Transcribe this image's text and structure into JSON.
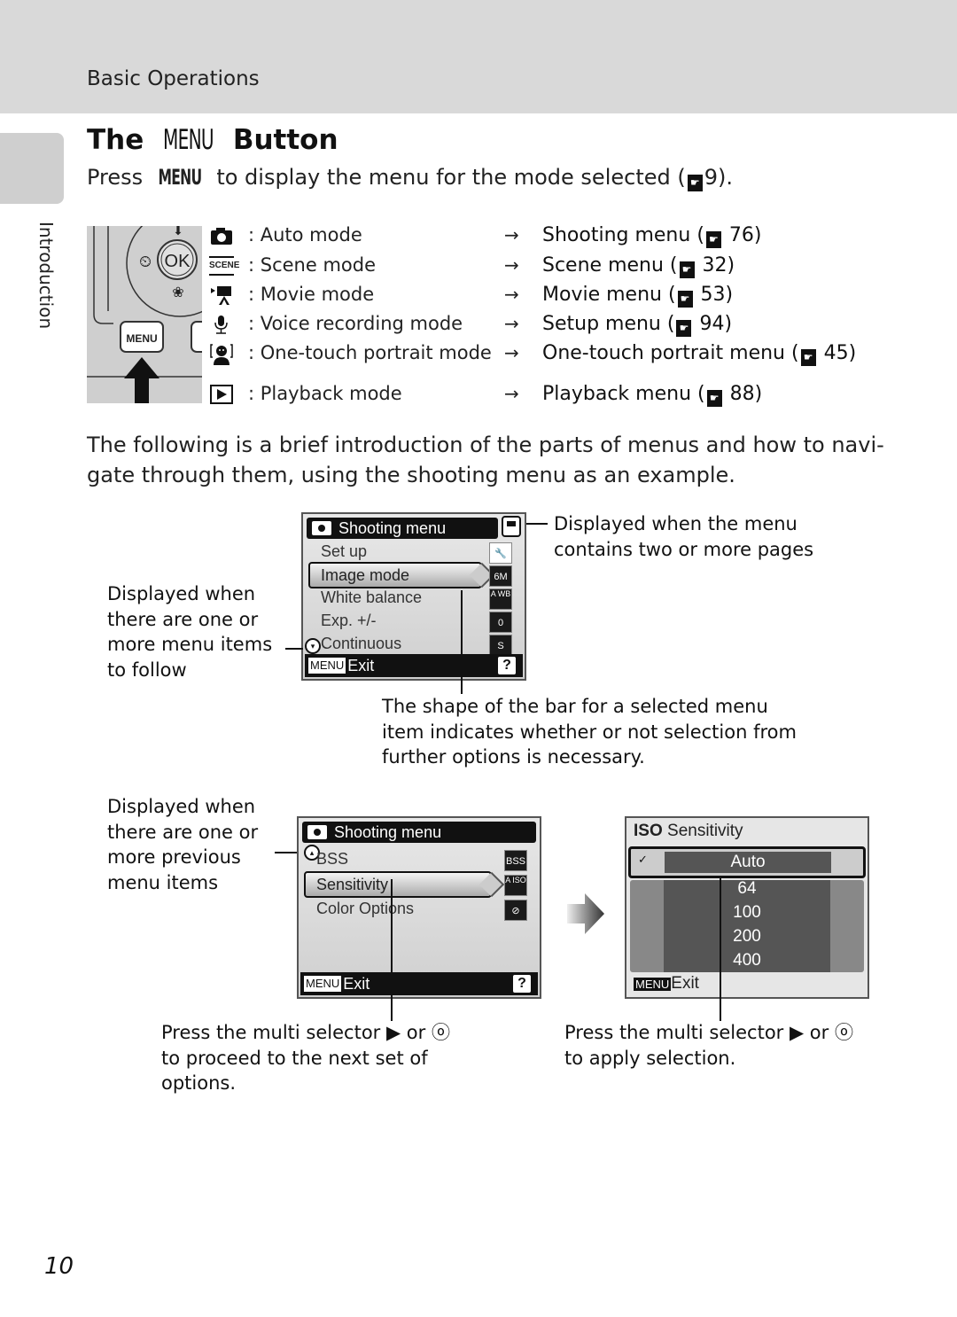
{
  "header": {
    "section": "Basic Operations",
    "side_tab": "Introduction"
  },
  "title": {
    "prefix": "The",
    "menu_glyph": "MENU",
    "suffix": "Button"
  },
  "intro": {
    "press": "Press",
    "menu_glyph": "MENU",
    "text": "to display the menu for the mode selected (",
    "ref_page": "9",
    "close": ")."
  },
  "camera_illustration": {
    "ok_label": "OK",
    "menu_button": "MENU"
  },
  "modes": [
    {
      "icon": "camera-icon",
      "glyph": "◘",
      "label": ": Auto mode",
      "arrow": "→",
      "menu": "Shooting menu (",
      "page": "76"
    },
    {
      "icon": "scene-icon",
      "glyph": "SCENE",
      "label": ": Scene mode",
      "arrow": "→",
      "menu": "Scene menu (",
      "page": "32"
    },
    {
      "icon": "movie-icon",
      "glyph": "▶■",
      "label": ": Movie mode",
      "arrow": "→",
      "menu": "Movie menu (",
      "page": "53"
    },
    {
      "icon": "microphone-icon",
      "glyph": "🎙",
      "label": ": Voice recording mode",
      "arrow": "→",
      "menu": "Setup menu (",
      "page": "94"
    },
    {
      "icon": "portrait-icon",
      "glyph": "☻",
      "label": ": One-touch portrait mode",
      "arrow": "→",
      "menu": "One-touch portrait menu (",
      "page": "45"
    },
    {
      "icon": "playback-icon",
      "glyph": "▶",
      "label": ": Playback mode",
      "arrow": "→",
      "menu": "Playback menu (",
      "page": "88"
    }
  ],
  "body_paragraph": "The following is a brief introduction of the parts of menus and how to navi-gate through them, using the shooting menu as an example.",
  "screen1": {
    "title": "Shooting menu",
    "items": [
      "Set up",
      "Image mode",
      "White balance",
      "Exp. +/-",
      "Continuous"
    ],
    "selected_index": 1,
    "item_icons": [
      "setup-icon",
      "6M",
      "A WB",
      "0",
      "S"
    ],
    "footer_badge": "MENU",
    "footer_label": "Exit",
    "help": "?"
  },
  "callouts": {
    "pages": "Displayed when the menu contains two or more pages",
    "follow": "Displayed when there are one or more menu items to follow",
    "bar_shape": "The shape of the bar for a selected menu item indicates whether or not selection from further options is necessary.",
    "previous": "Displayed when there are one or more previous menu items"
  },
  "screen2": {
    "title": "Shooting menu",
    "items": [
      "BSS",
      "Sensitivity",
      "Color Options"
    ],
    "selected_index": 1,
    "item_icons": [
      "BSS",
      "A ISO",
      "color-icon"
    ],
    "footer_badge": "MENU",
    "footer_label": "Exit",
    "help": "?"
  },
  "screen3": {
    "title_badge": "ISO",
    "title": "Sensitivity",
    "selected": "Auto",
    "options": [
      "64",
      "100",
      "200",
      "400"
    ],
    "footer_badge": "MENU",
    "footer_label": "Exit"
  },
  "footnotes": {
    "left": "Press the multi selector ▶ or ⓞ to proceed to the next set of options.",
    "right": "Press the multi selector ▶ or ⓞ to apply selection."
  },
  "page_number": "10"
}
